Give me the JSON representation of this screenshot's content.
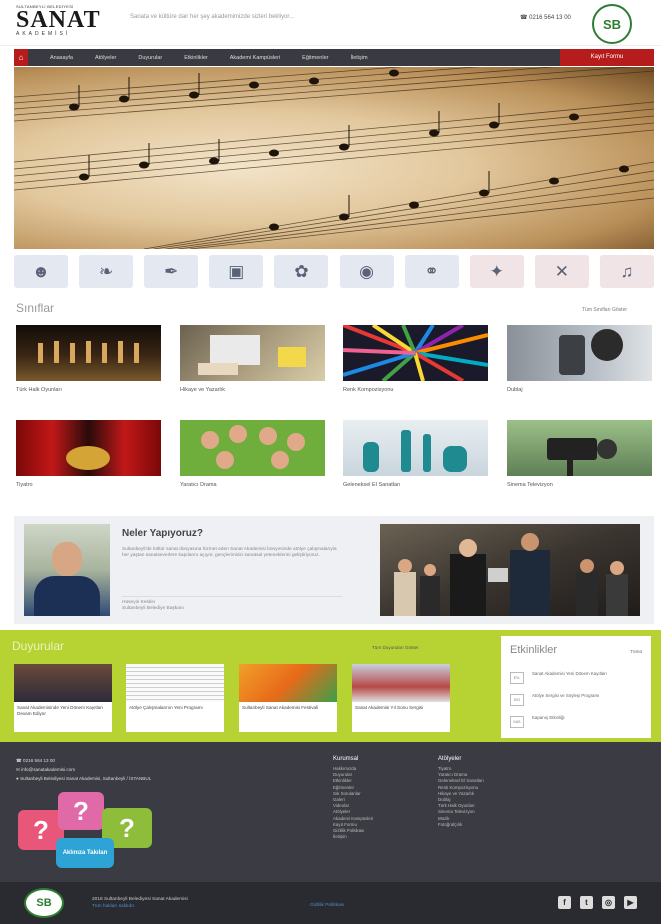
{
  "header": {
    "logo_small": "SULTANBEYLİ BELEDİYESİ",
    "logo_big": "SANAT",
    "logo_sub": "AKADEMİSİ",
    "tagline": "Sanata ve kültüre dair her şey akademimizde sizleri bekliyor...",
    "phone": "0216 564 13 00",
    "emblem": "SB"
  },
  "nav": {
    "home_icon": "home-icon",
    "items": [
      "Anasayfa",
      "Atölyeler",
      "Duyurular",
      "Etkinlikler",
      "Akademi Kampüsleri",
      "Eğitmenler",
      "İletişim"
    ],
    "cta": "Kayıt Formu"
  },
  "categories": [
    "theater-masks-icon",
    "dance-icon",
    "calligraphy-icon",
    "film-camera-icon",
    "palette-icon",
    "camera-icon",
    "microphone-icon",
    "folk-dance-icon",
    "crafts-icon",
    "music-notes-icon"
  ],
  "classes": {
    "title": "Sınıflar",
    "see_all": "Tüm Sınıfları Göster",
    "items": [
      {
        "label": "Türk Halk Oyunları"
      },
      {
        "label": "Hikaye ve Yazarlık"
      },
      {
        "label": "Renk Kompozisyonu"
      },
      {
        "label": "Dublaj"
      },
      {
        "label": "Tiyatro"
      },
      {
        "label": "Yaratıcı Drama"
      },
      {
        "label": "Geleneksel El Sanatları"
      },
      {
        "label": "Sinema Televizyon"
      }
    ]
  },
  "promo": {
    "title": "Neler Yapıyoruz?",
    "body": "Sultanbeyli'de kültür sanat dünyasına hizmet eden Sanat Akademisi bünyesinde atölye çalışmalarıyla her yaştan sanatseverlere kapılarını açıyor, gençlerimizin sanatsal yeteneklerini geliştiriyoruz.",
    "signature_name": "Hüseyin Keskin",
    "signature_title": "Sultanbeyli Belediye Başkanı"
  },
  "announcements": {
    "title": "Duyurular",
    "see_all": "Tüm Duyuruları Göster",
    "items": [
      {
        "caption": "Sanat Akademisinde Yeni Dönem Kayıtları Devam Ediyor"
      },
      {
        "caption": "Atölye Çalışmalarının Yeni Programı"
      },
      {
        "caption": "Sultanbeyli Sanat Akademisi Festivali"
      },
      {
        "caption": "Sanat Akademisi Yıl Sonu Sergisi"
      }
    ]
  },
  "events": {
    "title": "Etkinlikler",
    "see_all": "Tümü",
    "items": [
      {
        "date": "EYL",
        "text": "Sanat Akademisi Yeni Dönem Kayıtları"
      },
      {
        "date": "EKİ",
        "text": "Atölye Sergisi ve Söyleşi Programı"
      },
      {
        "date": "KAS",
        "text": "Kapanış Etkinliği"
      }
    ]
  },
  "footer": {
    "phone": "0216 564 13 00",
    "email": "info@sanatakademisi.com",
    "address": "Sultanbeyli Belediyesi Sanat Akademisi, Sultanbeyli / İSTANBUL",
    "bubble_text": "Aklınıza Takılan",
    "col1_title": "Kurumsal",
    "col1_links": [
      "Hakkımızda",
      "Duyurular",
      "Etkinlikler",
      "Eğitmenler",
      "Sık Sorulanlar",
      "Galeri",
      "Videolar",
      "Atölyeler",
      "Akademi Kampüsleri",
      "Kayıt Formu",
      "Gizlilik Politikası",
      "İletişim"
    ],
    "col2_title": "Atölyeler",
    "col2_links": [
      "Tiyatro",
      "Yaratıcı Drama",
      "Geleneksel El Sanatları",
      "Renk Kompozisyonu",
      "Hikaye ve Yazarlık",
      "Dublaj",
      "Türk Halk Oyunları",
      "Sinema Televizyon",
      "Müzik",
      "Fotoğrafçılık"
    ]
  },
  "bottom": {
    "copyright": "2018 Sultanbeyli Belediyesi Sanat Akademisi",
    "rights": "Tüm hakları saklıdır.",
    "link": "Gizlilik Politikası",
    "social": [
      "facebook-icon",
      "twitter-icon",
      "instagram-icon",
      "youtube-icon"
    ]
  }
}
